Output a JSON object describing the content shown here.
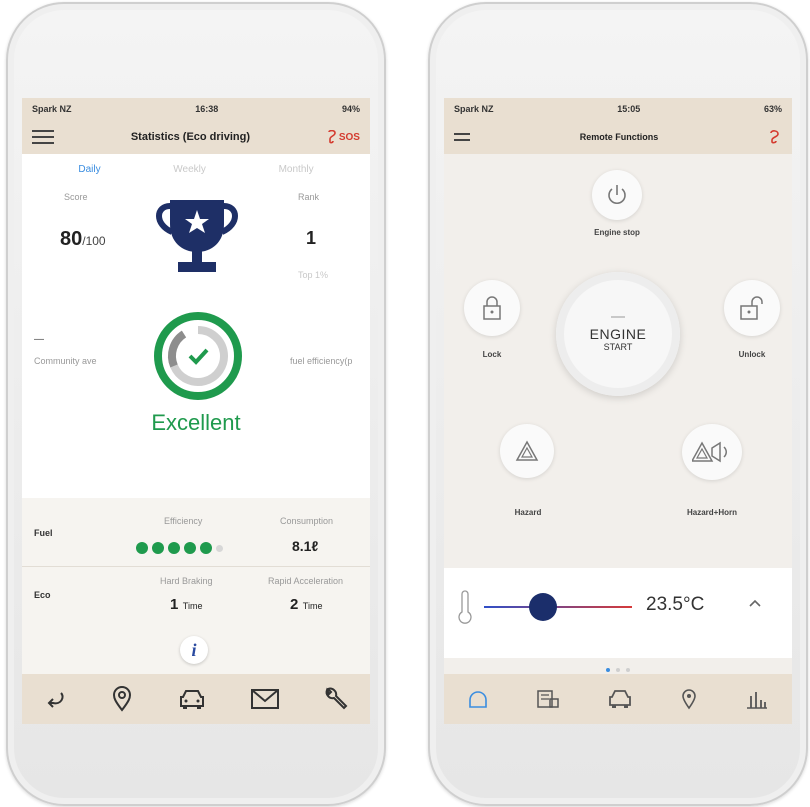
{
  "left": {
    "status": {
      "carrier": "Spark NZ",
      "time": "16:38",
      "battery": "94%"
    },
    "title": "Statistics (Eco driving)",
    "sos": "SOS",
    "tabs": [
      "Daily",
      "Weekly",
      "Monthly"
    ],
    "score": {
      "label": "Score",
      "value": "80",
      "suffix": "/100"
    },
    "rank": {
      "label": "Rank",
      "value": "1",
      "sub": "Top 1%"
    },
    "community": {
      "dash": "—",
      "label": "Community ave"
    },
    "fuel_eff_label": "fuel efficiency(p",
    "rating": "Excellent",
    "fuel": {
      "label": "Fuel",
      "efficiency_label": "Efficiency",
      "efficiency_level": 5,
      "efficiency_max": 6,
      "consumption_label": "Consumption",
      "consumption_value": "8.1ℓ"
    },
    "eco": {
      "label": "Eco",
      "braking_label": "Hard Braking",
      "braking_value": "1",
      "braking_unit": "Time",
      "accel_label": "Rapid Acceleration",
      "accel_value": "2",
      "accel_unit": "Time"
    },
    "info_icon": "i"
  },
  "right": {
    "status": {
      "carrier": "Spark NZ",
      "time": "15:05",
      "battery": "63%"
    },
    "title": "Remote Functions",
    "engine_stop": "Engine stop",
    "lock": "Lock",
    "unlock": "Unlock",
    "engine_start_line1": "ENGINE",
    "engine_start_line2": "START",
    "hazard": "Hazard",
    "hazard_horn": "Hazard+Horn",
    "temperature": "23.5°C",
    "temperature_level": 0.4,
    "page_dots": {
      "count": 3,
      "active": 1
    }
  },
  "colors": {
    "header": "#e9dfd1",
    "accent_green": "#1f9a4d",
    "trophy": "#1e2f66",
    "sos_red": "#d43b2f",
    "active_tab": "#3a8de0"
  }
}
